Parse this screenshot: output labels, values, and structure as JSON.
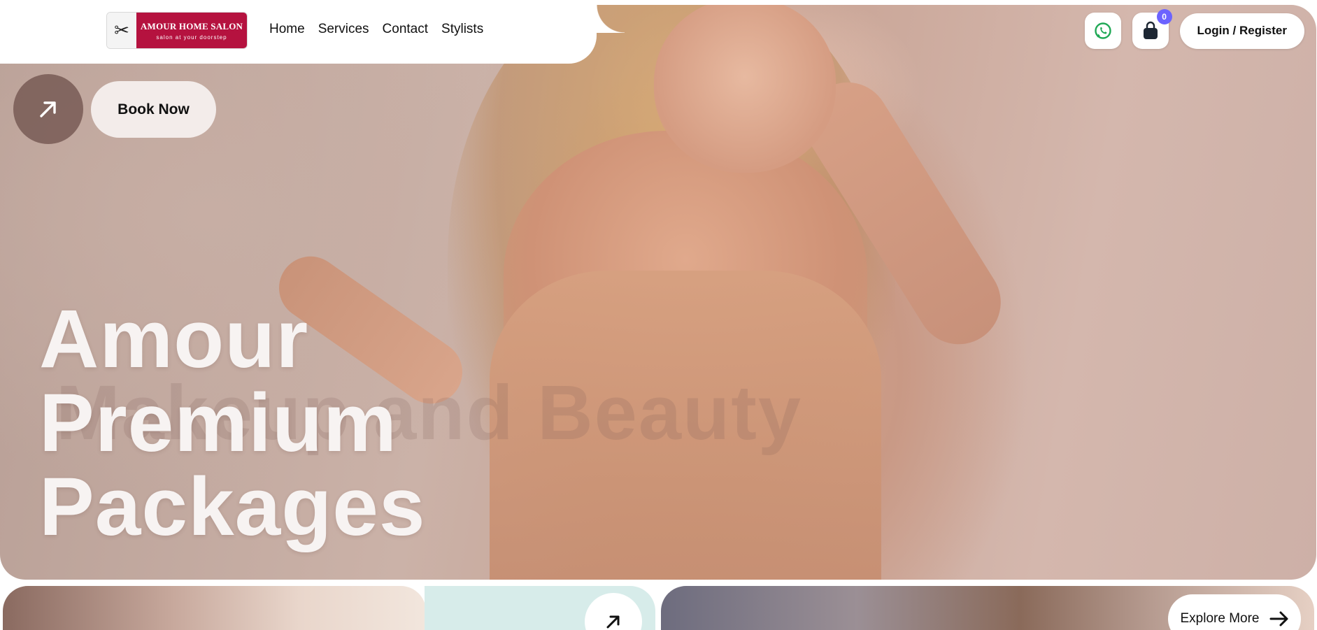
{
  "brand": {
    "name": "AMOUR HOME SALON",
    "tagline": "salon at your doorstep"
  },
  "nav": {
    "links": [
      "Home",
      "Services",
      "Contact",
      "Stylists"
    ],
    "cart_count": "0",
    "login_label": "Login / Register",
    "icons": {
      "whatsapp": "whatsapp-icon",
      "cart": "shopping-bag-icon"
    }
  },
  "hero": {
    "book_label": "Book Now",
    "title_lines": [
      "Amour",
      "Premium",
      "Packages"
    ],
    "ghost_text": "Makeup and Beauty"
  },
  "cards": {
    "explore_label": "Explore More"
  },
  "colors": {
    "brand_red": "#b5123f",
    "badge": "#6c63ff",
    "card_mint": "#d7ecea"
  }
}
